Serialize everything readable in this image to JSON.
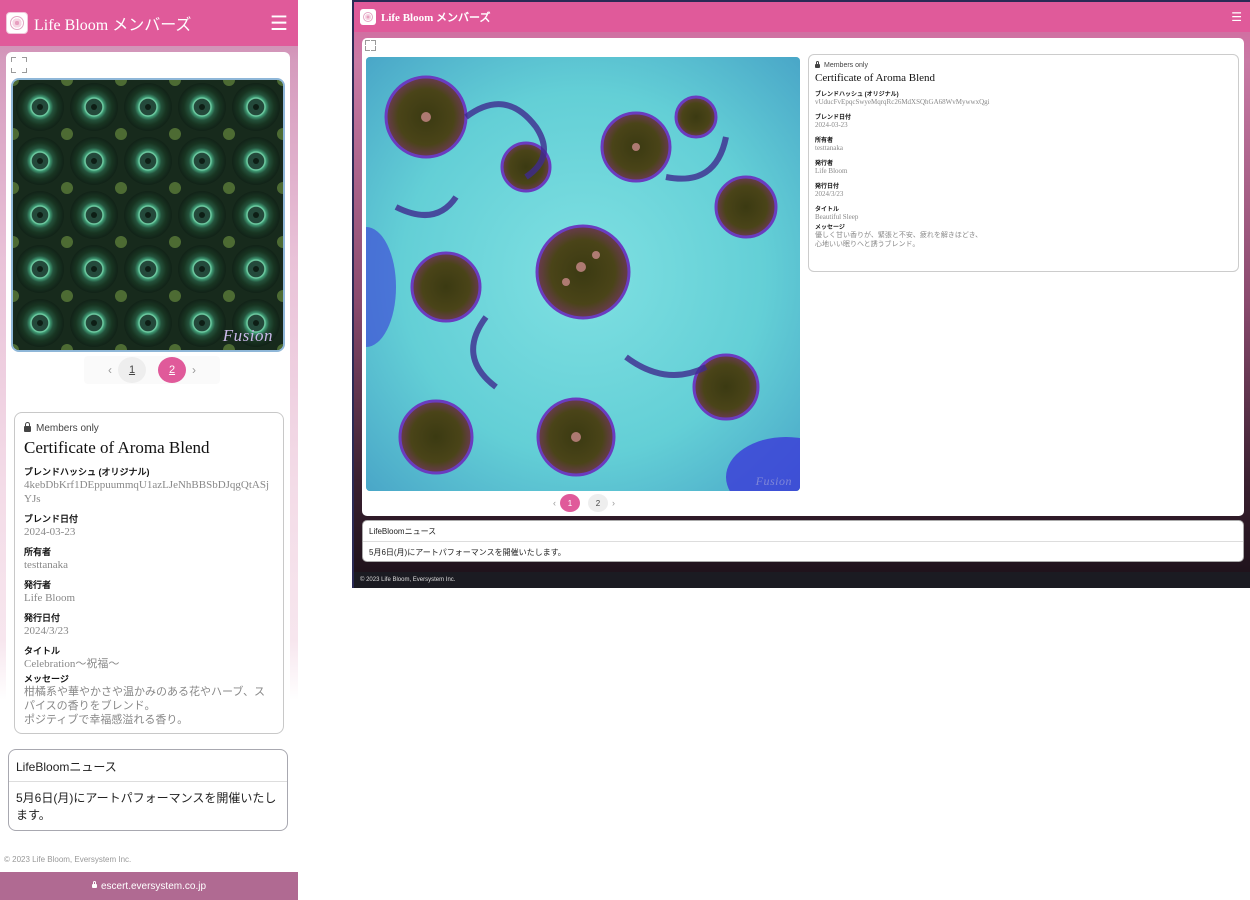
{
  "app": {
    "title": "Life Bloom メンバーズ",
    "menu_icon": "hamburger-icon",
    "logo_icon": "flower-logo-icon",
    "accent_color": "#e05a9a"
  },
  "mobile": {
    "artwork": {
      "watermark": "Fusion"
    },
    "pager": {
      "prev": "‹",
      "next": "›",
      "pages": [
        "1",
        "2"
      ],
      "active_page": "2"
    },
    "certificate": {
      "badge": "Members only",
      "title": "Certificate of Aroma Blend",
      "fields": [
        {
          "label": "ブレンドハッシュ (オリジナル)",
          "value": "4kebDbKrf1DEppuummqU1azLJeNhBBSbDJqgQtASjYJs"
        },
        {
          "label": "ブレンド日付",
          "value": "2024-03-23"
        },
        {
          "label": "所有者",
          "value": "testtanaka"
        },
        {
          "label": "発行者",
          "value": "Life Bloom"
        },
        {
          "label": "発行日付",
          "value": "2024/3/23"
        },
        {
          "label": "タイトル",
          "value": "Celebration〜祝福〜"
        }
      ],
      "message_label": "メッセージ",
      "message_lines": [
        "柑橘系や華やかさや温かみのある花やハーブ、スパイスの香りをブレンド。",
        "ポジティブで幸福感溢れる香り。"
      ]
    },
    "news": {
      "title": "LifeBloomニュース",
      "body": "5月6日(月)にアートパフォーマンスを開催いたします。"
    },
    "footer": "© 2023 Life Bloom, Eversystem Inc.",
    "url": "escert.eversystem.co.jp"
  },
  "desktop": {
    "artwork": {
      "watermark": "Fusion"
    },
    "pager": {
      "prev": "‹",
      "next": "›",
      "pages": [
        "1",
        "2"
      ],
      "active_page": "1"
    },
    "certificate": {
      "badge": "Members only",
      "title": "Certificate of Aroma Blend",
      "fields": [
        {
          "label": "ブレンドハッシュ (オリジナル)",
          "value": "vUducFvEpqcSwyeMqrqRc26MdXSQhGA68WvMywwxQgi"
        },
        {
          "label": "ブレンド日付",
          "value": "2024-03-23"
        },
        {
          "label": "所有者",
          "value": "testtanaka"
        },
        {
          "label": "発行者",
          "value": "Life Bloom"
        },
        {
          "label": "発行日付",
          "value": "2024/3/23"
        },
        {
          "label": "タイトル",
          "value": "Beautiful Sleep"
        }
      ],
      "message_label": "メッセージ",
      "message_lines": [
        "優しく甘い香りが、緊張と不安、疲れを解きほどき、",
        "心地いい眠りへと誘うブレンド。"
      ]
    },
    "news": {
      "title": "LifeBloomニュース",
      "body": "5月6日(月)にアートパフォーマンスを開催いたします。"
    },
    "footer": "© 2023 Life Bloom, Eversystem Inc."
  }
}
